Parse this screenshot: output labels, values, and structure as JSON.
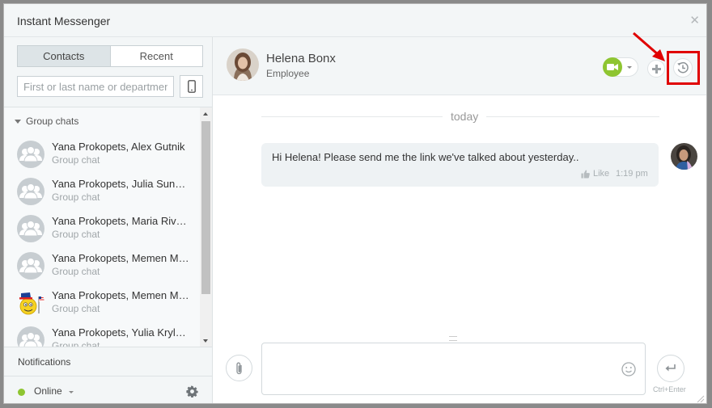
{
  "window": {
    "title": "Instant Messenger",
    "close_icon": "close-icon"
  },
  "sidebar": {
    "tabs": [
      {
        "label": "Contacts",
        "active": true
      },
      {
        "label": "Recent",
        "active": false
      }
    ],
    "search": {
      "placeholder": "First or last name or department",
      "value": ""
    },
    "group_header": "Group chats",
    "items": [
      {
        "name": "Yana Prokopets, Alex Gutnik",
        "sub": "Group chat",
        "avatar": "group-avatar-icon"
      },
      {
        "name": "Yana Prokopets, Julia Sunshine",
        "sub": "Group chat",
        "avatar": "group-avatar-icon"
      },
      {
        "name": "Yana Prokopets, Maria Rivers",
        "sub": "Group chat",
        "avatar": "group-avatar-icon"
      },
      {
        "name": "Yana Prokopets, Memen Memen",
        "sub": "Group chat",
        "avatar": "group-avatar-icon"
      },
      {
        "name": "Yana Prokopets, Memen Memen",
        "sub": "Group chat",
        "avatar": "emoji-flag-avatar"
      },
      {
        "name": "Yana Prokopets, Yulia Krylova",
        "sub": "Group chat",
        "avatar": "group-avatar-icon"
      }
    ],
    "notifications_label": "Notifications",
    "status": {
      "label": "Online",
      "color": "#8ec531"
    }
  },
  "chat": {
    "contact": {
      "name": "Helena Bonx",
      "role": "Employee"
    },
    "day_separator": "today",
    "messages": [
      {
        "text": "Hi Helena! Please send me the link we've talked about yesterday..",
        "like_label": "Like",
        "time": "1:19 pm"
      }
    ],
    "send_hint": "Ctrl+Enter"
  },
  "colors": {
    "accent_green": "#8ec531",
    "highlight_red": "#e00000"
  }
}
